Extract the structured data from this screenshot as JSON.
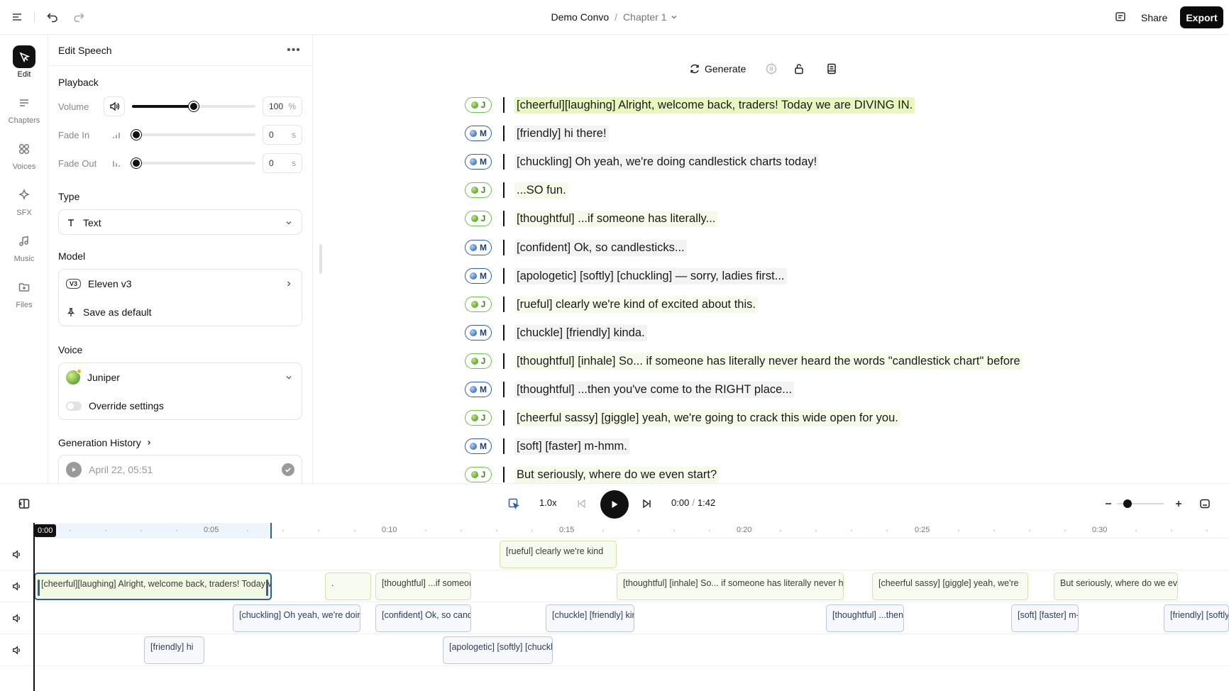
{
  "topbar": {
    "project": "Demo Convo",
    "separator": "/",
    "chapter": "Chapter 1",
    "share_label": "Share",
    "export_label": "Export"
  },
  "rail": {
    "items": [
      {
        "label": "Edit",
        "icon": "wand-icon",
        "active": true
      },
      {
        "label": "Chapters",
        "icon": "list-icon"
      },
      {
        "label": "Voices",
        "icon": "grid-circles-icon"
      },
      {
        "label": "SFX",
        "icon": "sparkle-gear-icon"
      },
      {
        "label": "Music",
        "icon": "music-note-icon"
      },
      {
        "label": "Files",
        "icon": "folder-plus-icon"
      }
    ]
  },
  "panel": {
    "title": "Edit Speech",
    "playback": {
      "title": "Playback",
      "volume_label": "Volume",
      "volume_value": "100",
      "volume_unit": "%",
      "volume_level": 0.5,
      "fade_in_label": "Fade In",
      "fade_in_value": "0",
      "fade_in_unit": "s",
      "fade_out_label": "Fade Out",
      "fade_out_value": "0",
      "fade_out_unit": "s"
    },
    "type": {
      "title": "Type",
      "value": "Text"
    },
    "model": {
      "title": "Model",
      "badge": "V3",
      "value": "Eleven v3",
      "save_default": "Save as default"
    },
    "voice": {
      "title": "Voice",
      "value": "Juniper",
      "override_label": "Override settings"
    },
    "history": {
      "title": "Generation History",
      "item_date": "April 22, 05:51"
    }
  },
  "script": {
    "generate_label": "Generate",
    "lines": [
      {
        "speaker": "J",
        "text": "[cheerful][laughing] Alright, welcome back, traders! Today we are DIVING IN.",
        "highlight": true
      },
      {
        "speaker": "M",
        "text": "[friendly] hi there!"
      },
      {
        "speaker": "M",
        "text": "[chuckling] Oh yeah, we're doing candlestick charts today!"
      },
      {
        "speaker": "J",
        "text": "...SO fun."
      },
      {
        "speaker": "J",
        "text": "[thoughtful] ...if someone has literally..."
      },
      {
        "speaker": "M",
        "text": "[confident] Ok, so candlesticks..."
      },
      {
        "speaker": "M",
        "text": "[apologetic] [softly] [chuckling] — sorry, ladies first..."
      },
      {
        "speaker": "J",
        "text": "[rueful] clearly we're kind of excited about this."
      },
      {
        "speaker": "M",
        "text": "[chuckle] [friendly] kinda."
      },
      {
        "speaker": "J",
        "text": "[thoughtful] [inhale] So... if someone has literally never heard the words \"candlestick chart\" before"
      },
      {
        "speaker": "M",
        "text": "[thoughtful] ...then you've come to the RIGHT place..."
      },
      {
        "speaker": "J",
        "text": "[cheerful sassy] [giggle] yeah, we're going to crack this wide open for you."
      },
      {
        "speaker": "M",
        "text": "[soft] [faster] m-hmm."
      },
      {
        "speaker": "J",
        "text": "But seriously, where do we even start?"
      }
    ]
  },
  "transport": {
    "speed": "1.0x",
    "current": "0:00",
    "separator": "/",
    "total": "1:42"
  },
  "timeline": {
    "current_badge": "0:00",
    "ticks": [
      "0:05",
      "0:10",
      "0:15",
      "0:20",
      "0:25",
      "0:30"
    ],
    "clips": [
      {
        "track": 0,
        "speaker": "J",
        "text": "[rueful] clearly we're kind",
        "start": 13.1,
        "end": 16.4
      },
      {
        "track": 1,
        "speaker": "J",
        "text": "[cheerful][laughing] Alright, welcome back, traders! Today we are DIVING IN.",
        "start": 0.0,
        "end": 6.7,
        "selected": true
      },
      {
        "track": 1,
        "speaker": "J",
        "text": ".",
        "start": 8.2,
        "end": 9.5
      },
      {
        "track": 1,
        "speaker": "J",
        "text": "[thoughtful] ...if someone has literally...",
        "start": 9.6,
        "end": 12.3
      },
      {
        "track": 1,
        "speaker": "J",
        "text": "[thoughtful] [inhale] So... if someone has literally never heard the words",
        "start": 16.4,
        "end": 22.8
      },
      {
        "track": 1,
        "speaker": "J",
        "text": "[cheerful sassy] [giggle] yeah, we're",
        "start": 23.6,
        "end": 28.0
      },
      {
        "track": 1,
        "speaker": "J",
        "text": "But seriously, where do we even start?",
        "start": 28.7,
        "end": 32.2
      },
      {
        "track": 2,
        "speaker": "M",
        "text": "[chuckling] Oh yeah, we're doing candlestick charts today!",
        "start": 5.6,
        "end": 9.2
      },
      {
        "track": 2,
        "speaker": "M",
        "text": "[confident] Ok, so candlesticks...",
        "start": 9.6,
        "end": 12.3
      },
      {
        "track": 2,
        "speaker": "M",
        "text": "[chuckle] [friendly] kinda.",
        "start": 14.4,
        "end": 16.9
      },
      {
        "track": 2,
        "speaker": "M",
        "text": "[thoughtful] ...then you've come to the RIGHT place...",
        "start": 22.3,
        "end": 24.5
      },
      {
        "track": 2,
        "speaker": "M",
        "text": "[soft] [faster] m-hmm.",
        "start": 27.5,
        "end": 29.4
      },
      {
        "track": 2,
        "speaker": "M",
        "text": "[friendly] [softly] So",
        "start": 31.8,
        "end": 35.0
      },
      {
        "track": 3,
        "speaker": "M",
        "text": "[friendly] hi",
        "start": 3.1,
        "end": 4.8
      },
      {
        "track": 3,
        "speaker": "M",
        "text": "[apologetic] [softly] [chuckling]",
        "start": 11.5,
        "end": 14.6
      }
    ]
  }
}
